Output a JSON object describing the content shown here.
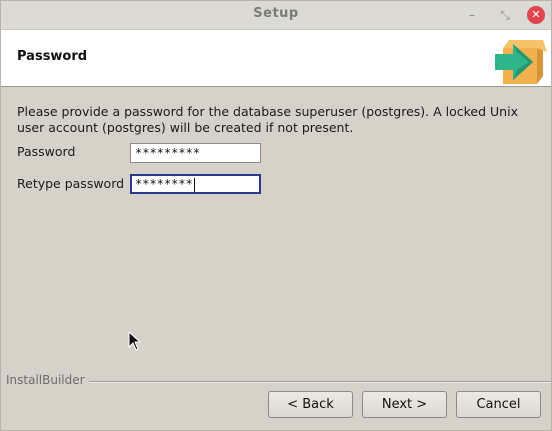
{
  "window": {
    "title": "Setup",
    "minimize_icon": "minimize-icon",
    "maximize_icon": "maximize-icon",
    "close_icon": "close-icon"
  },
  "header": {
    "title": "Password",
    "logo_icon": "installer-box-arrow-icon"
  },
  "main": {
    "intro": "Please provide a password for the database superuser (postgres). A locked Unix user account (postgres) will be created if not present.",
    "password_label": "Password",
    "password_value": "*********",
    "retype_label": "Retype password",
    "retype_value": "********"
  },
  "footer": {
    "brand": "InstallBuilder",
    "back_label": "< Back",
    "next_label": "Next >",
    "cancel_label": "Cancel"
  },
  "colors": {
    "accent_focus": "#2b3a8f",
    "close_button": "#e0464f",
    "window_bg": "#d6d2ca"
  }
}
